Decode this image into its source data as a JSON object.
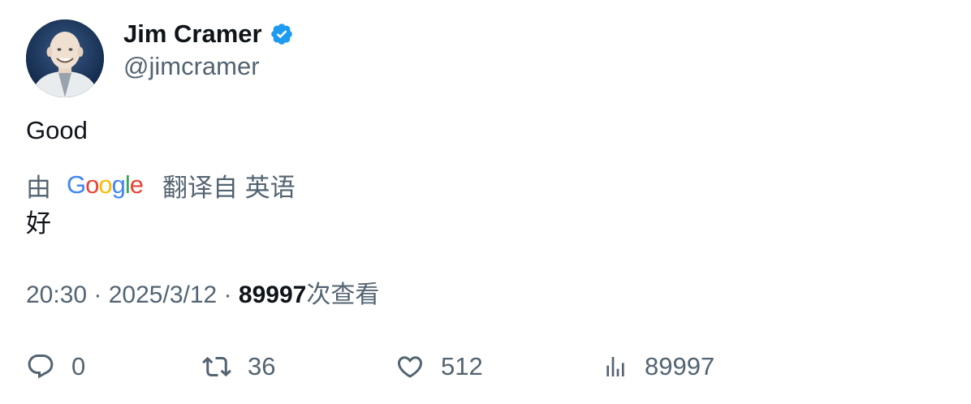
{
  "author": {
    "display_name": "Jim Cramer",
    "handle": "@jimcramer",
    "verified": true
  },
  "tweet": {
    "text": "Good",
    "translation": {
      "prefix": "由",
      "provider_logo": "Google",
      "suffix": "翻译自 英语",
      "text": "好"
    },
    "meta": {
      "time": "20:30",
      "sep1": " · ",
      "date": "2025/3/12",
      "sep2": " · ",
      "views": "89997",
      "views_label": "次查看"
    }
  },
  "actions": {
    "reply": {
      "icon": "reply-icon",
      "count": "0"
    },
    "retweet": {
      "icon": "retweet-icon",
      "count": "36"
    },
    "like": {
      "icon": "heart-icon",
      "count": "512"
    },
    "views": {
      "icon": "analytics-icon",
      "count": "89997"
    }
  },
  "colors": {
    "text_primary": "#0f1419",
    "text_secondary": "#536471",
    "verified_blue": "#1d9bf0",
    "google_blue": "#4285f4",
    "google_red": "#ea4335",
    "google_yellow": "#fbbc05",
    "google_green": "#34a853"
  }
}
